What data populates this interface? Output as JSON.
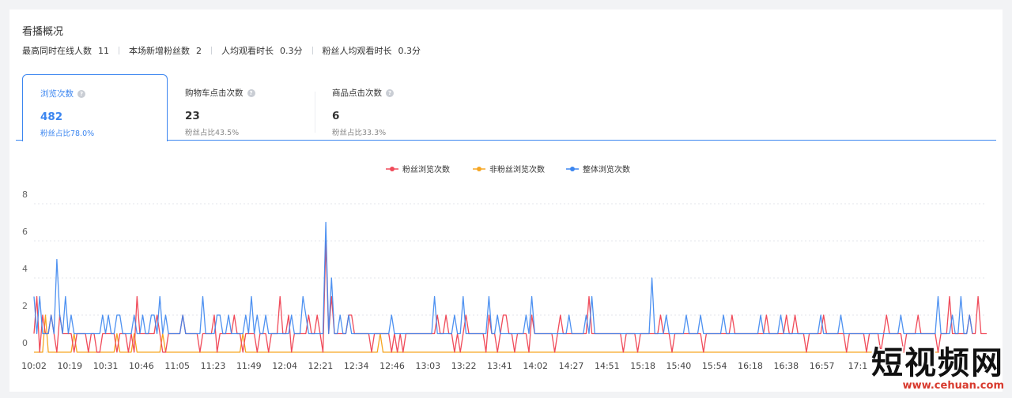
{
  "section": {
    "title": "看播概况",
    "stats": [
      {
        "label": "最高同时在线人数",
        "value": "11"
      },
      {
        "label": "本场新增粉丝数",
        "value": "2"
      },
      {
        "label": "人均观看时长",
        "value": "0.3分"
      },
      {
        "label": "粉丝人均观看时长",
        "value": "0.3分"
      }
    ]
  },
  "tabs": [
    {
      "label": "浏览次数",
      "value": "482",
      "sub": "粉丝占比78.0%",
      "active": true
    },
    {
      "label": "购物车点击次数",
      "value": "23",
      "sub": "粉丝占比43.5%",
      "active": false
    },
    {
      "label": "商品点击次数",
      "value": "6",
      "sub": "粉丝占比33.3%",
      "active": false
    }
  ],
  "icons": {
    "help": "question-circle-icon"
  },
  "colors": {
    "accent": "#3c86f0",
    "fans": "#f04b5a",
    "nonfans": "#f6a623",
    "total": "#3c86f0"
  },
  "watermark": {
    "main": "短视频网",
    "url": "www.cehuan.com"
  },
  "chart_data": {
    "type": "line",
    "title": "",
    "xlabel": "",
    "ylabel": "",
    "ylim": [
      0,
      8
    ],
    "yticks": [
      0,
      2,
      4,
      6,
      8
    ],
    "grid": true,
    "legend_position": "top-center",
    "x_tick_labels": [
      "10:02",
      "10:19",
      "10:31",
      "10:46",
      "11:05",
      "11:23",
      "11:49",
      "12:04",
      "12:21",
      "12:34",
      "12:46",
      "13:03",
      "13:22",
      "13:41",
      "14:02",
      "14:27",
      "14:51",
      "15:18",
      "15:40",
      "15:54",
      "16:18",
      "16:38",
      "16:57",
      "17:1",
      "",
      "",
      ""
    ],
    "series": [
      {
        "name": "粉丝浏览次数",
        "color": "#f04b5a",
        "values": [
          1,
          3,
          0,
          2,
          1,
          1,
          2,
          1,
          0,
          2,
          1,
          1,
          1,
          1,
          0,
          1,
          1,
          1,
          1,
          0,
          1,
          1,
          0,
          0,
          1,
          1,
          1,
          1,
          1,
          0,
          1,
          1,
          1,
          0,
          1,
          0,
          3,
          1,
          1,
          1,
          1,
          1,
          1,
          2,
          1,
          0,
          0,
          1,
          1,
          1,
          1,
          1,
          2,
          1,
          1,
          1,
          1,
          1,
          0,
          1,
          1,
          1,
          1,
          2,
          0,
          1,
          1,
          1,
          1,
          1,
          2,
          1,
          1,
          0,
          1,
          1,
          1,
          1,
          0,
          1,
          1,
          1,
          0,
          1,
          1,
          1,
          3,
          1,
          1,
          2,
          0,
          1,
          1,
          1,
          1,
          1,
          2,
          1,
          1,
          2,
          1,
          0,
          6,
          1,
          3,
          1,
          1,
          1,
          1,
          1,
          2,
          2,
          1,
          1,
          1,
          1,
          1,
          1,
          0,
          1,
          1,
          1,
          1,
          1,
          1,
          0,
          1,
          0,
          1,
          0,
          1,
          1,
          1,
          1,
          1,
          1,
          1,
          1,
          1,
          1,
          1,
          2,
          1,
          1,
          2,
          1,
          1,
          0,
          1,
          0,
          1,
          2,
          1,
          1,
          1,
          1,
          1,
          1,
          0,
          2,
          1,
          1,
          0,
          1,
          2,
          2,
          1,
          1,
          0,
          1,
          1,
          1,
          1,
          0,
          2,
          1,
          1,
          1,
          1,
          1,
          1,
          1,
          0,
          1,
          2,
          1,
          1,
          1,
          1,
          1,
          1,
          1,
          1,
          1,
          3,
          1,
          1,
          1,
          1,
          1,
          1,
          1,
          1,
          1,
          1,
          1,
          0,
          1,
          1,
          1,
          1,
          0,
          1,
          1,
          1,
          1,
          1,
          1,
          1,
          2,
          1,
          1,
          1,
          0,
          1,
          1,
          1,
          1,
          1,
          1,
          1,
          1,
          1,
          1,
          0,
          1,
          1,
          1,
          1,
          1,
          1,
          1,
          1,
          1,
          2,
          1,
          1,
          1,
          1,
          1,
          1,
          1,
          1,
          1,
          1,
          1,
          2,
          1,
          1,
          1,
          1,
          1,
          1,
          2,
          1,
          1,
          2,
          1,
          1,
          1,
          0,
          1,
          1,
          1,
          1,
          1,
          2,
          1,
          1,
          1,
          1,
          1,
          1,
          1,
          0,
          1,
          1,
          1,
          1,
          1,
          1,
          0,
          1,
          1,
          1,
          1,
          0,
          1,
          2,
          1,
          1,
          1,
          1,
          1,
          0,
          1,
          1,
          1,
          1,
          2,
          1,
          1,
          1,
          1,
          1,
          1,
          0,
          1,
          1,
          1,
          3,
          1,
          1,
          1,
          1,
          1,
          1,
          2,
          1,
          1,
          3,
          1,
          1,
          1
        ]
      },
      {
        "name": "非粉丝浏览次数",
        "color": "#f6a623",
        "values": [
          0,
          0,
          0,
          0,
          2,
          0,
          0,
          0,
          0,
          0,
          0,
          0,
          0,
          0,
          1,
          0,
          0,
          0,
          0,
          0,
          0,
          0,
          0,
          0,
          0,
          0,
          0,
          0,
          0,
          1,
          0,
          0,
          0,
          0,
          0,
          1,
          0,
          0,
          0,
          0,
          0,
          0,
          0,
          0,
          0,
          1,
          0,
          0,
          0,
          0,
          0,
          0,
          0,
          0,
          0,
          0,
          0,
          0,
          0,
          0,
          0,
          0,
          0,
          0,
          0,
          0,
          0,
          0,
          0,
          0,
          0,
          0,
          0,
          1,
          0,
          0,
          0,
          0,
          0,
          0,
          0,
          0,
          0,
          0,
          0,
          0,
          0,
          0,
          0,
          0,
          0,
          0,
          0,
          0,
          0,
          0,
          0,
          0,
          0,
          0,
          0,
          0,
          0,
          0,
          0,
          0,
          0,
          0,
          0,
          0,
          0,
          0,
          0,
          0,
          0,
          0,
          0,
          0,
          0,
          0,
          0,
          1,
          0,
          0,
          0,
          0,
          0,
          0,
          0,
          0,
          0,
          0,
          0,
          0,
          0,
          0,
          0,
          0,
          0,
          0,
          0,
          0,
          0,
          0,
          0,
          0,
          0,
          0,
          0,
          0,
          0,
          0,
          0,
          0,
          0,
          0,
          0,
          0,
          0,
          0,
          0,
          0,
          0,
          0,
          0,
          0,
          0,
          0,
          0,
          0,
          0,
          0,
          0,
          0,
          0,
          0,
          0,
          0,
          0,
          0,
          0,
          0,
          0,
          0,
          0,
          0,
          0,
          0,
          0,
          0,
          0,
          0,
          0,
          0,
          0,
          0,
          0,
          0,
          0,
          0,
          0,
          0,
          0,
          0,
          0,
          0,
          0,
          0,
          0,
          0,
          0,
          0,
          0,
          0,
          0,
          0,
          0,
          0,
          0,
          0,
          0,
          0,
          0,
          0,
          0,
          0,
          0,
          0,
          0,
          0,
          0,
          0,
          0,
          0,
          0,
          0,
          0,
          0,
          0,
          0,
          0,
          0,
          0,
          0,
          0,
          0,
          0,
          0,
          0,
          0,
          0,
          0,
          0,
          0,
          0,
          0,
          0,
          0,
          0,
          0,
          0,
          0,
          0,
          0,
          0,
          0,
          0,
          0,
          0,
          0,
          0,
          0,
          0,
          0,
          0,
          0,
          0,
          0,
          0,
          0,
          0,
          0,
          0,
          0,
          0,
          0,
          0,
          0,
          0,
          0,
          0,
          0,
          0,
          0,
          0,
          0,
          0,
          0,
          0,
          0,
          0,
          0,
          0,
          0,
          0,
          0,
          0,
          0,
          0,
          0,
          0,
          0,
          0,
          0,
          0,
          0,
          0,
          0,
          0,
          0,
          0,
          0,
          0
        ]
      },
      {
        "name": "整体浏览次数",
        "color": "#3c86f0",
        "values": [
          3,
          1,
          3,
          1,
          1,
          1,
          2,
          1,
          5,
          2,
          1,
          3,
          1,
          2,
          1,
          1,
          1,
          1,
          1,
          1,
          1,
          1,
          1,
          1,
          2,
          1,
          2,
          1,
          1,
          2,
          2,
          1,
          1,
          1,
          1,
          2,
          1,
          1,
          2,
          1,
          1,
          2,
          2,
          1,
          3,
          1,
          2,
          1,
          1,
          1,
          1,
          1,
          2,
          1,
          1,
          1,
          1,
          1,
          1,
          3,
          1,
          1,
          1,
          1,
          2,
          2,
          1,
          1,
          2,
          1,
          1,
          1,
          1,
          1,
          2,
          1,
          3,
          1,
          2,
          1,
          1,
          2,
          1,
          1,
          1,
          1,
          1,
          1,
          1,
          1,
          2,
          1,
          1,
          1,
          3,
          2,
          1,
          1,
          1,
          1,
          1,
          1,
          7,
          1,
          4,
          1,
          1,
          2,
          1,
          1,
          2,
          1,
          1,
          1,
          1,
          1,
          1,
          1,
          1,
          1,
          1,
          1,
          1,
          1,
          1,
          2,
          1,
          1,
          1,
          1,
          1,
          1,
          1,
          1,
          1,
          1,
          1,
          1,
          1,
          1,
          3,
          1,
          1,
          1,
          1,
          1,
          1,
          2,
          1,
          1,
          3,
          1,
          1,
          1,
          1,
          1,
          1,
          1,
          1,
          3,
          1,
          1,
          2,
          1,
          1,
          1,
          1,
          1,
          1,
          1,
          1,
          1,
          2,
          1,
          3,
          1,
          1,
          1,
          1,
          1,
          1,
          1,
          1,
          1,
          1,
          1,
          1,
          2,
          1,
          1,
          1,
          1,
          1,
          2,
          1,
          3,
          1,
          1,
          1,
          1,
          1,
          1,
          1,
          1,
          1,
          1,
          1,
          1,
          1,
          1,
          1,
          1,
          1,
          1,
          1,
          1,
          4,
          1,
          1,
          1,
          1,
          2,
          1,
          1,
          1,
          1,
          1,
          1,
          2,
          1,
          1,
          1,
          1,
          2,
          1,
          1,
          1,
          1,
          1,
          1,
          1,
          2,
          1,
          1,
          1,
          1,
          1,
          1,
          1,
          1,
          1,
          1,
          1,
          1,
          2,
          1,
          1,
          1,
          1,
          1,
          1,
          2,
          1,
          1,
          1,
          1,
          1,
          1,
          1,
          1,
          1,
          1,
          1,
          1,
          1,
          2,
          1,
          1,
          1,
          1,
          1,
          1,
          2,
          1,
          1,
          1,
          1,
          1,
          1,
          1,
          1,
          1,
          1,
          1,
          1,
          1,
          1,
          1,
          1,
          1,
          1,
          1,
          1,
          2,
          1,
          1,
          1,
          1,
          1,
          1,
          1,
          1,
          1,
          1,
          1,
          1,
          3,
          1,
          1,
          1,
          1,
          2,
          1,
          1,
          3,
          1,
          1,
          2,
          1
        ]
      }
    ]
  }
}
